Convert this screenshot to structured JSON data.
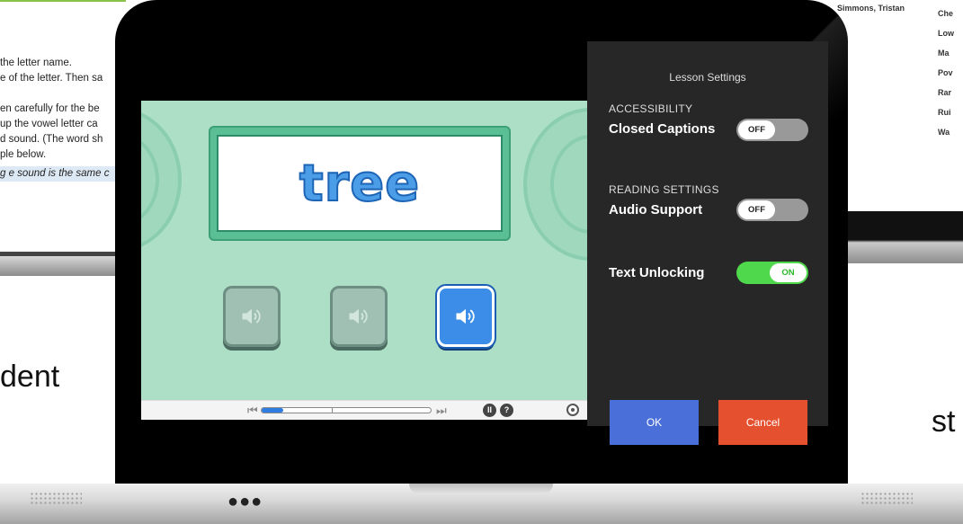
{
  "background_left": {
    "lines": [
      "the letter name.",
      "e of the letter. Then sa",
      "",
      "en carefully for the be",
      "up the vowel letter ca",
      "d sound. (The word sh",
      "ple below."
    ],
    "highlight": "g e sound is the same c"
  },
  "background_right": {
    "top_name": "Simmons, Tristan",
    "names": [
      "Che",
      "Low",
      "Ma",
      "Pov",
      "Rar",
      "Rui",
      "Wa"
    ]
  },
  "background_text": {
    "left": "dent",
    "right": "st"
  },
  "lesson": {
    "word": "tree",
    "sound_buttons": [
      {
        "state": "disabled"
      },
      {
        "state": "disabled"
      },
      {
        "state": "active"
      }
    ],
    "progress": 0.13
  },
  "settings": {
    "title": "Lesson Settings",
    "accessibility_header": "ACCESSIBILITY",
    "closed_captions_label": "Closed Captions",
    "closed_captions_state": "OFF",
    "reading_header": "READING SETTINGS",
    "audio_support_label": "Audio Support",
    "audio_support_state": "OFF",
    "text_unlocking_label": "Text Unlocking",
    "text_unlocking_state": "ON",
    "ok_label": "OK",
    "cancel_label": "Cancel"
  },
  "colors": {
    "toggle_on": "#4fd84c",
    "ok": "#4a6fd8",
    "cancel": "#e5502f",
    "lesson_bg": "#acdfc6"
  }
}
